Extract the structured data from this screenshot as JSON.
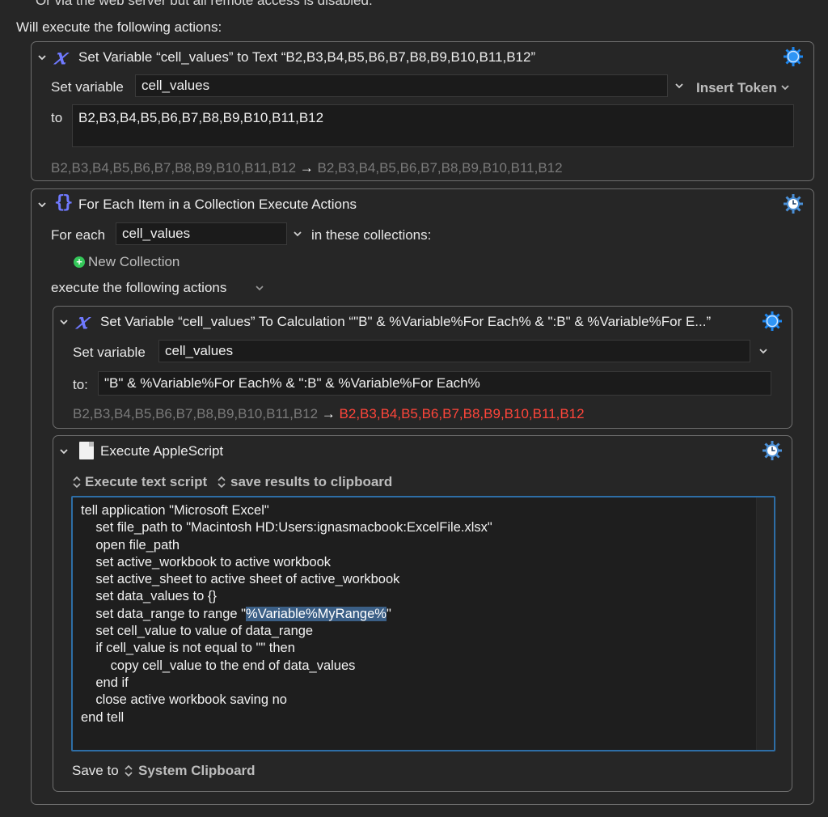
{
  "header": {
    "top_cut": "Or via the web server but all remote access is disabled.",
    "will_execute": "Will execute the following actions:"
  },
  "action1": {
    "title": "Set Variable “cell_values” to Text “B2,B3,B4,B5,B6,B7,B8,B9,B10,B11,B12”",
    "set_variable_label": "Set variable",
    "variable_value": "cell_values",
    "insert_token": "Insert Token",
    "to_label": "to",
    "text_value": "B2,B3,B4,B5,B6,B7,B8,B9,B10,B11,B12",
    "preview_before": "B2,B3,B4,B5,B6,B7,B8,B9,B10,B11,B12",
    "preview_arrow": "→",
    "preview_after": "B2,B3,B4,B5,B6,B7,B8,B9,B10,B11,B12"
  },
  "action2": {
    "title": "For Each Item in a Collection Execute Actions",
    "for_each_label": "For each",
    "variable_value": "cell_values",
    "in_collections": "in these collections:",
    "new_collection": "New Collection",
    "execute_following": "execute the following actions"
  },
  "action3": {
    "title": "Set Variable “cell_values” To Calculation “\"B\" & %Variable%For Each% & \":B\" & %Variable%For E...”",
    "set_variable_label": "Set variable",
    "variable_value": "cell_values",
    "to_label": "to:",
    "calc_value": "\"B\" & %Variable%For Each% & \":B\" & %Variable%For Each%",
    "preview_before": "B2,B3,B4,B5,B6,B7,B8,B9,B10,B11,B12",
    "preview_arrow": "→",
    "preview_after": "B2,B3,B4,B5,B6,B7,B8,B9,B10,B11,B12"
  },
  "action4": {
    "title": "Execute AppleScript",
    "mode": "Execute text script",
    "result_mode": "save results to clipboard",
    "script_before": "tell application \"Microsoft Excel\"\n    set file_path to \"Macintosh HD:Users:ignasmacbook:ExcelFile.xlsx\"\n    open file_path\n    set active_workbook to active workbook\n    set active_sheet to active sheet of active_workbook\n    set data_values to {}\n    set data_range to range \"",
    "script_highlight": "%Variable%MyRange%",
    "script_after": "\"\n    set cell_value to value of data_range\n    if cell_value is not equal to \"\" then\n        copy cell_value to the end of data_values\n    end if\n    close active workbook saving no\nend tell",
    "save_to_label": "Save to",
    "save_to_value": "System Clipboard"
  },
  "colors": {
    "accent": "#6f79ff",
    "gear_blue": "#1d87f0",
    "error_red": "#ff453a",
    "add_green": "#34c759"
  }
}
